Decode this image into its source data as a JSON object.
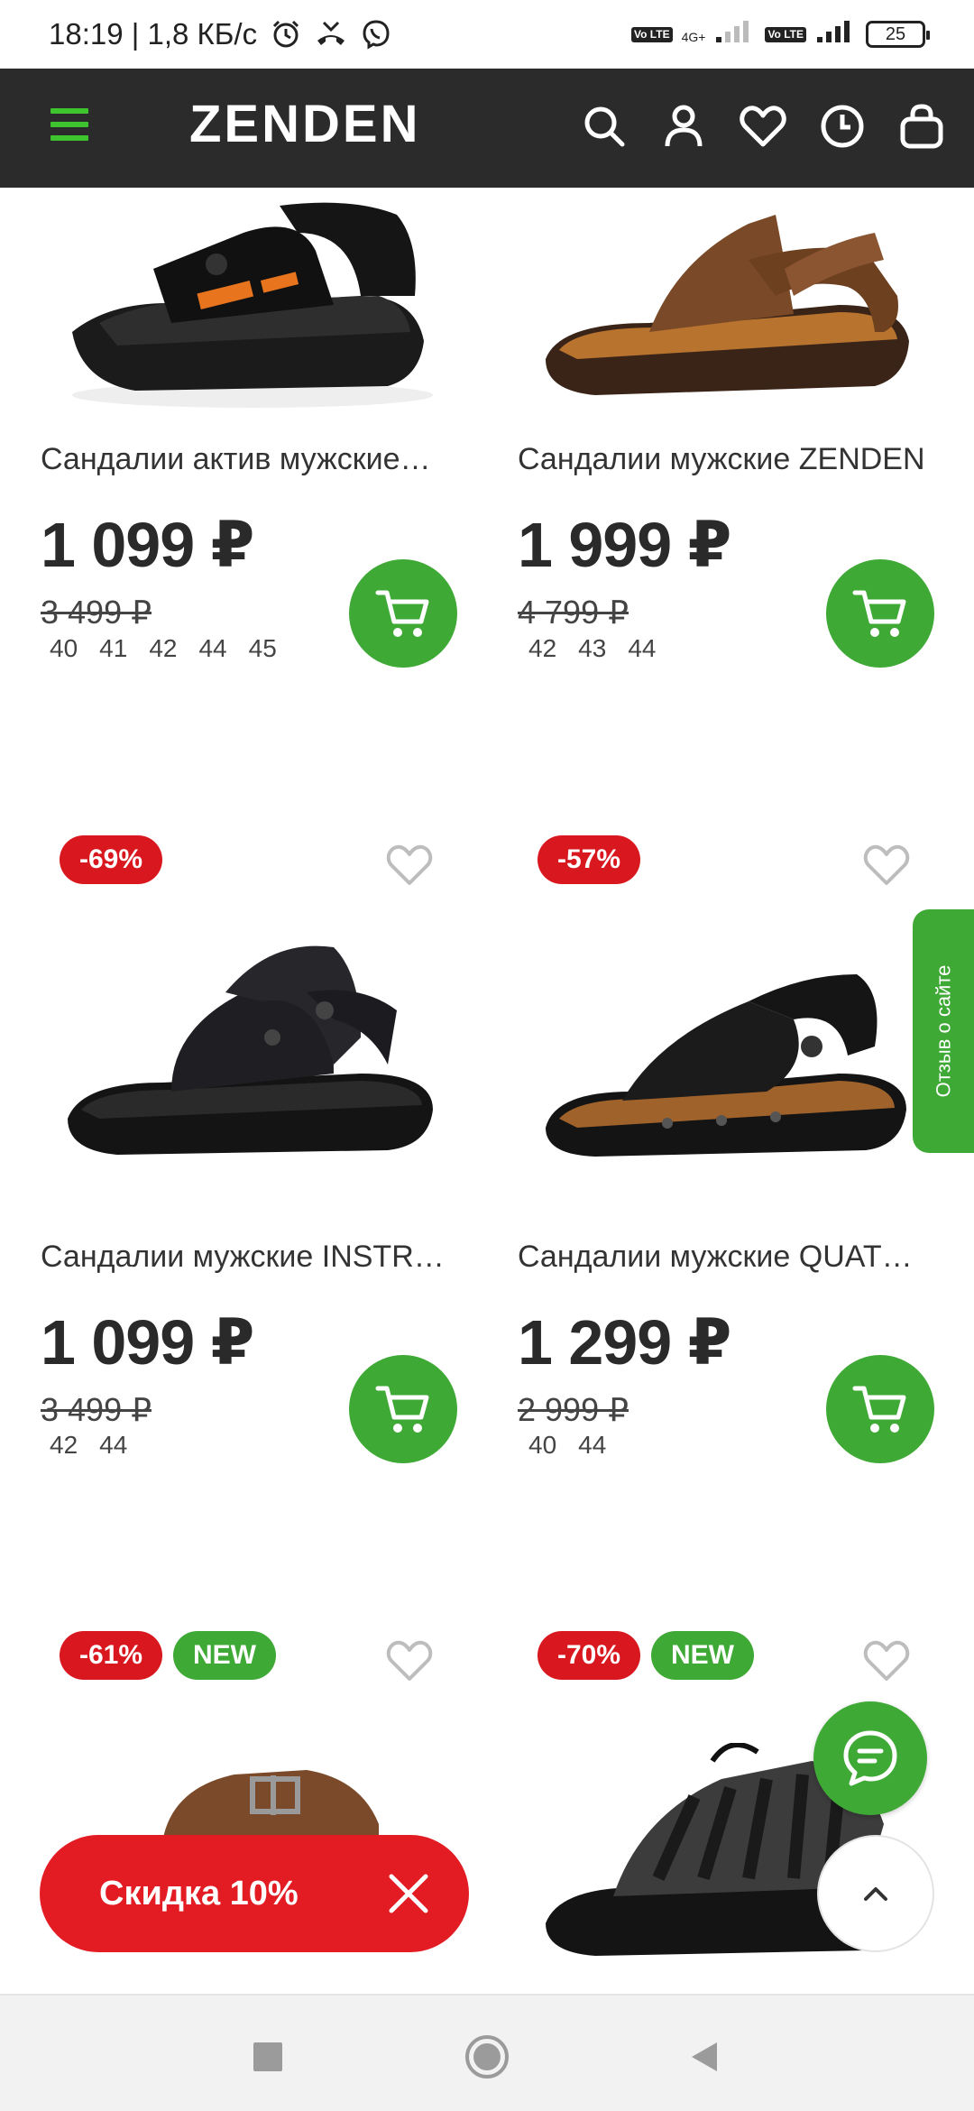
{
  "status_bar": {
    "time_speed": "18:19 | 1,8 КБ/с",
    "net_label": "4G+",
    "volte": "Vo LTE",
    "battery": "25"
  },
  "header": {
    "logo": "ZENDEN",
    "accent_color": "#3ec42f"
  },
  "products": [
    {
      "name": "Сандалии актив мужские…",
      "price": "1 099 ₽",
      "old_price": "3 499 ₽",
      "sizes": [
        "40",
        "41",
        "42",
        "44",
        "45"
      ],
      "badges": []
    },
    {
      "name": "Сандалии мужские ZENDEN",
      "price": "1 999 ₽",
      "old_price": "4 799 ₽",
      "sizes": [
        "42",
        "43",
        "44"
      ],
      "badges": []
    },
    {
      "name": "Сандалии мужские INSTR…",
      "price": "1 099 ₽",
      "old_price": "3 499 ₽",
      "sizes": [
        "42",
        "44"
      ],
      "badges": [
        {
          "text": "-69%",
          "type": "red"
        }
      ]
    },
    {
      "name": "Сандалии мужские QUAT…",
      "price": "1 299 ₽",
      "old_price": "2 999 ₽",
      "sizes": [
        "40",
        "44"
      ],
      "badges": [
        {
          "text": "-57%",
          "type": "red"
        }
      ]
    },
    {
      "badges": [
        {
          "text": "-61%",
          "type": "red"
        },
        {
          "text": "NEW",
          "type": "green"
        }
      ]
    },
    {
      "badges": [
        {
          "text": "-70%",
          "type": "red"
        },
        {
          "text": "NEW",
          "type": "green"
        }
      ]
    }
  ],
  "side_tab": {
    "label": "Отзыв о сайте"
  },
  "discount_bar": {
    "label": "Скидка 10%"
  },
  "colors": {
    "green": "#3fa936",
    "red": "#d9171e",
    "header_bg": "#2b2b2b"
  }
}
